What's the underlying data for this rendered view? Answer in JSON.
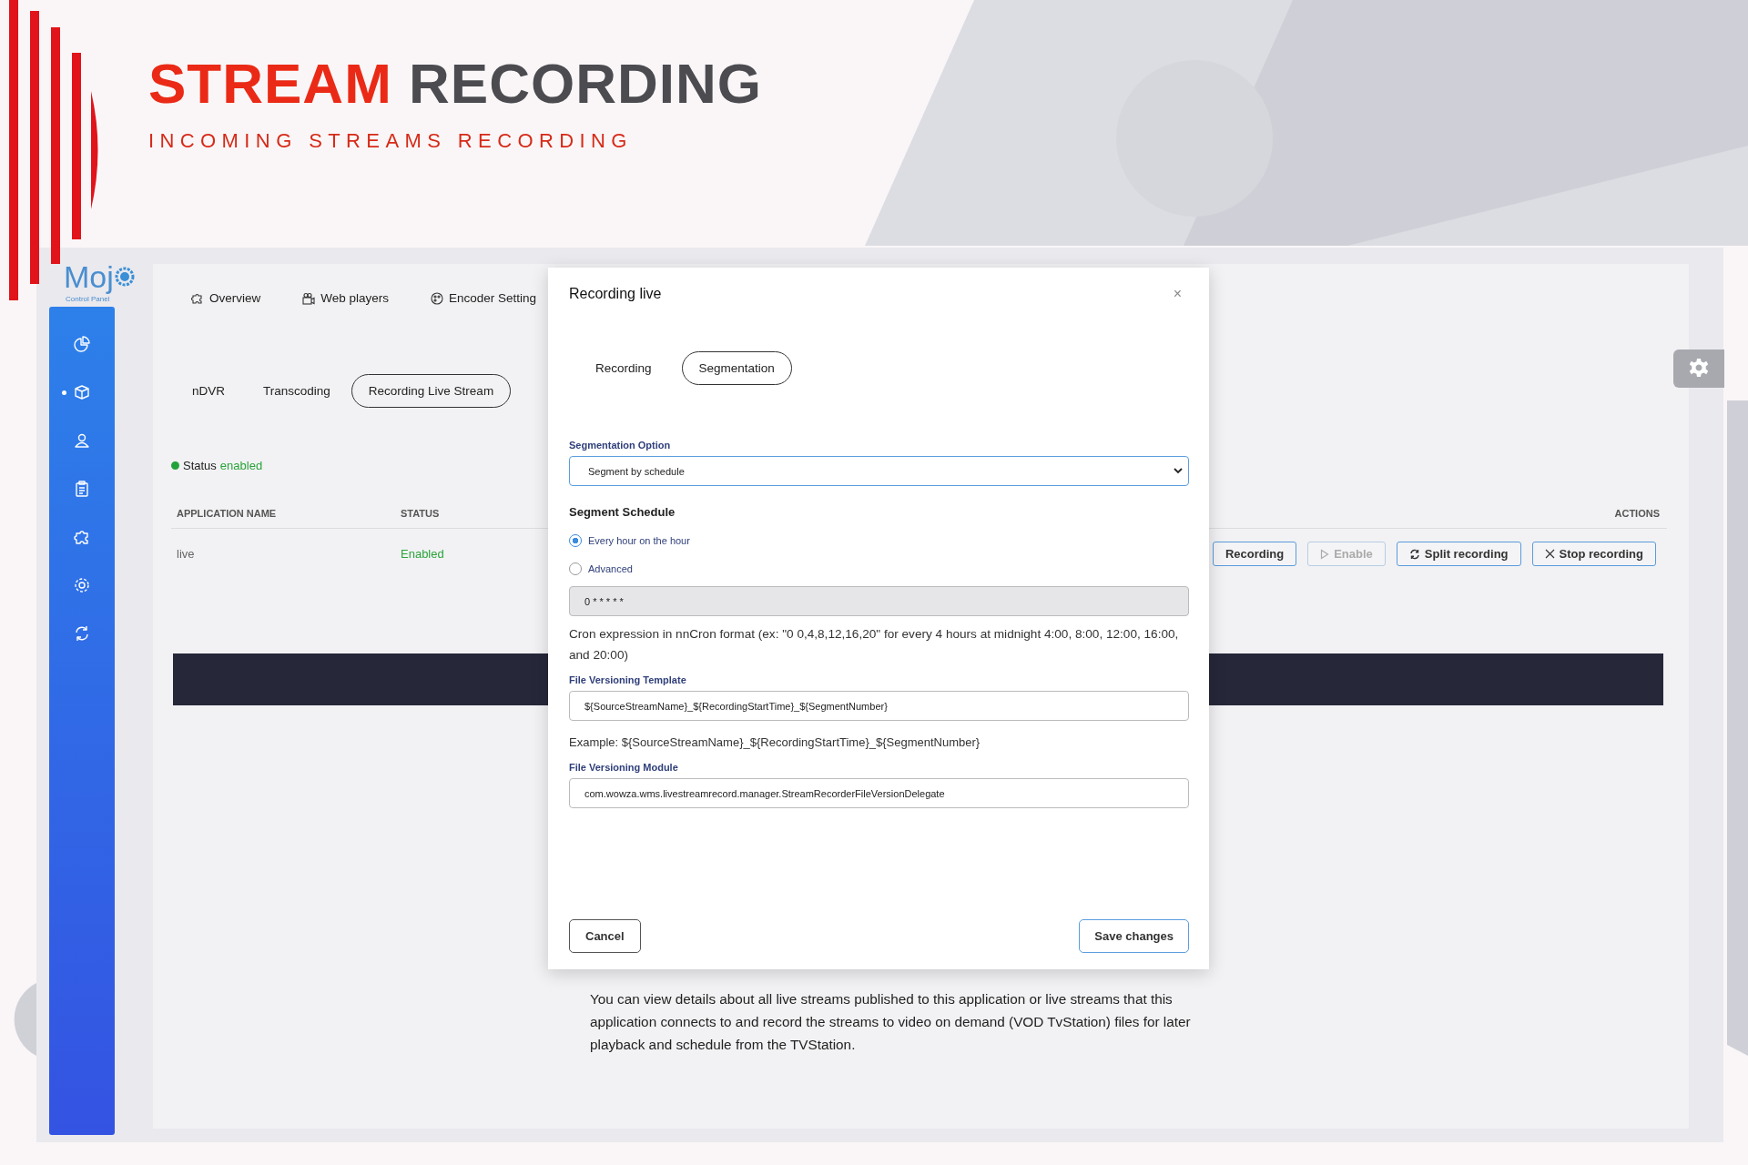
{
  "banner": {
    "title_accent": "STREAM",
    "title_rest": "RECORDING",
    "subtitle": "INCOMING STREAMS RECORDING"
  },
  "logo": {
    "text": "Moj",
    "subtitle": "Control Panel"
  },
  "sidebar": {
    "items": [
      {
        "kind": "pie",
        "selected": false
      },
      {
        "kind": "box",
        "selected": true
      },
      {
        "kind": "user",
        "selected": false
      },
      {
        "kind": "clipboard",
        "selected": false
      },
      {
        "kind": "puzzle",
        "selected": false
      },
      {
        "kind": "gear",
        "selected": false
      },
      {
        "kind": "refresh",
        "selected": false
      }
    ]
  },
  "top_nav": [
    {
      "label": "Overview",
      "kind": "puzzle"
    },
    {
      "label": "Web players",
      "kind": "players"
    },
    {
      "label": "Encoder Setting",
      "kind": "palette"
    }
  ],
  "sub_tabs": [
    {
      "label": "nDVR",
      "selected": false
    },
    {
      "label": "Transcoding",
      "selected": false
    },
    {
      "label": "Recording Live Stream",
      "selected": true
    }
  ],
  "status": {
    "label": "Status",
    "value": "enabled"
  },
  "table": {
    "columns": [
      "APPLICATION NAME",
      "STATUS",
      "ACTIONS"
    ],
    "rows": [
      {
        "cells": [
          "live",
          "Enabled"
        ],
        "actions": [
          {
            "label": "Recording",
            "kind": "plain",
            "disabled": false
          },
          {
            "label": "Enable",
            "kind": "play",
            "disabled": true
          },
          {
            "label": "Split recording",
            "kind": "split",
            "disabled": false
          },
          {
            "label": "Stop recording",
            "kind": "stop",
            "disabled": false
          }
        ]
      }
    ]
  },
  "description": "You can view details about all live streams published to this application or live streams that this application connects to and record the streams to video on demand (VOD TvStation) files for later playback and schedule from the TVStation.",
  "modal": {
    "title": "Recording live",
    "close": "×",
    "tabs": [
      {
        "label": "Recording",
        "selected": false
      },
      {
        "label": "Segmentation",
        "selected": true
      }
    ],
    "segmentation_option": {
      "label": "Segmentation Option",
      "value": "Segment by schedule"
    },
    "schedule": {
      "title": "Segment Schedule",
      "options": [
        {
          "label": "Every hour on the hour",
          "selected": true
        },
        {
          "label": "Advanced",
          "selected": false
        }
      ],
      "cron": {
        "value": "0 * * * * *",
        "disabled": true
      },
      "help": "Cron expression in nnCron format (ex: \"0 0,4,8,12,16,20\" for every 4 hours at midnight 4:00, 8:00, 12:00, 16:00, and 20:00)"
    },
    "template": {
      "label": "File Versioning Template",
      "value": "${SourceStreamName}_${RecordingStartTime}_${SegmentNumber}"
    },
    "example": "Example: ${SourceStreamName}_${RecordingStartTime}_${SegmentNumber}",
    "module": {
      "label": "File Versioning Module",
      "value": "com.wowza.wms.livestreamrecord.manager.StreamRecorderFileVersionDelegate"
    },
    "buttons": [
      {
        "label": "Cancel",
        "kind": "secondary"
      },
      {
        "label": "Save changes",
        "kind": "primary"
      }
    ]
  }
}
